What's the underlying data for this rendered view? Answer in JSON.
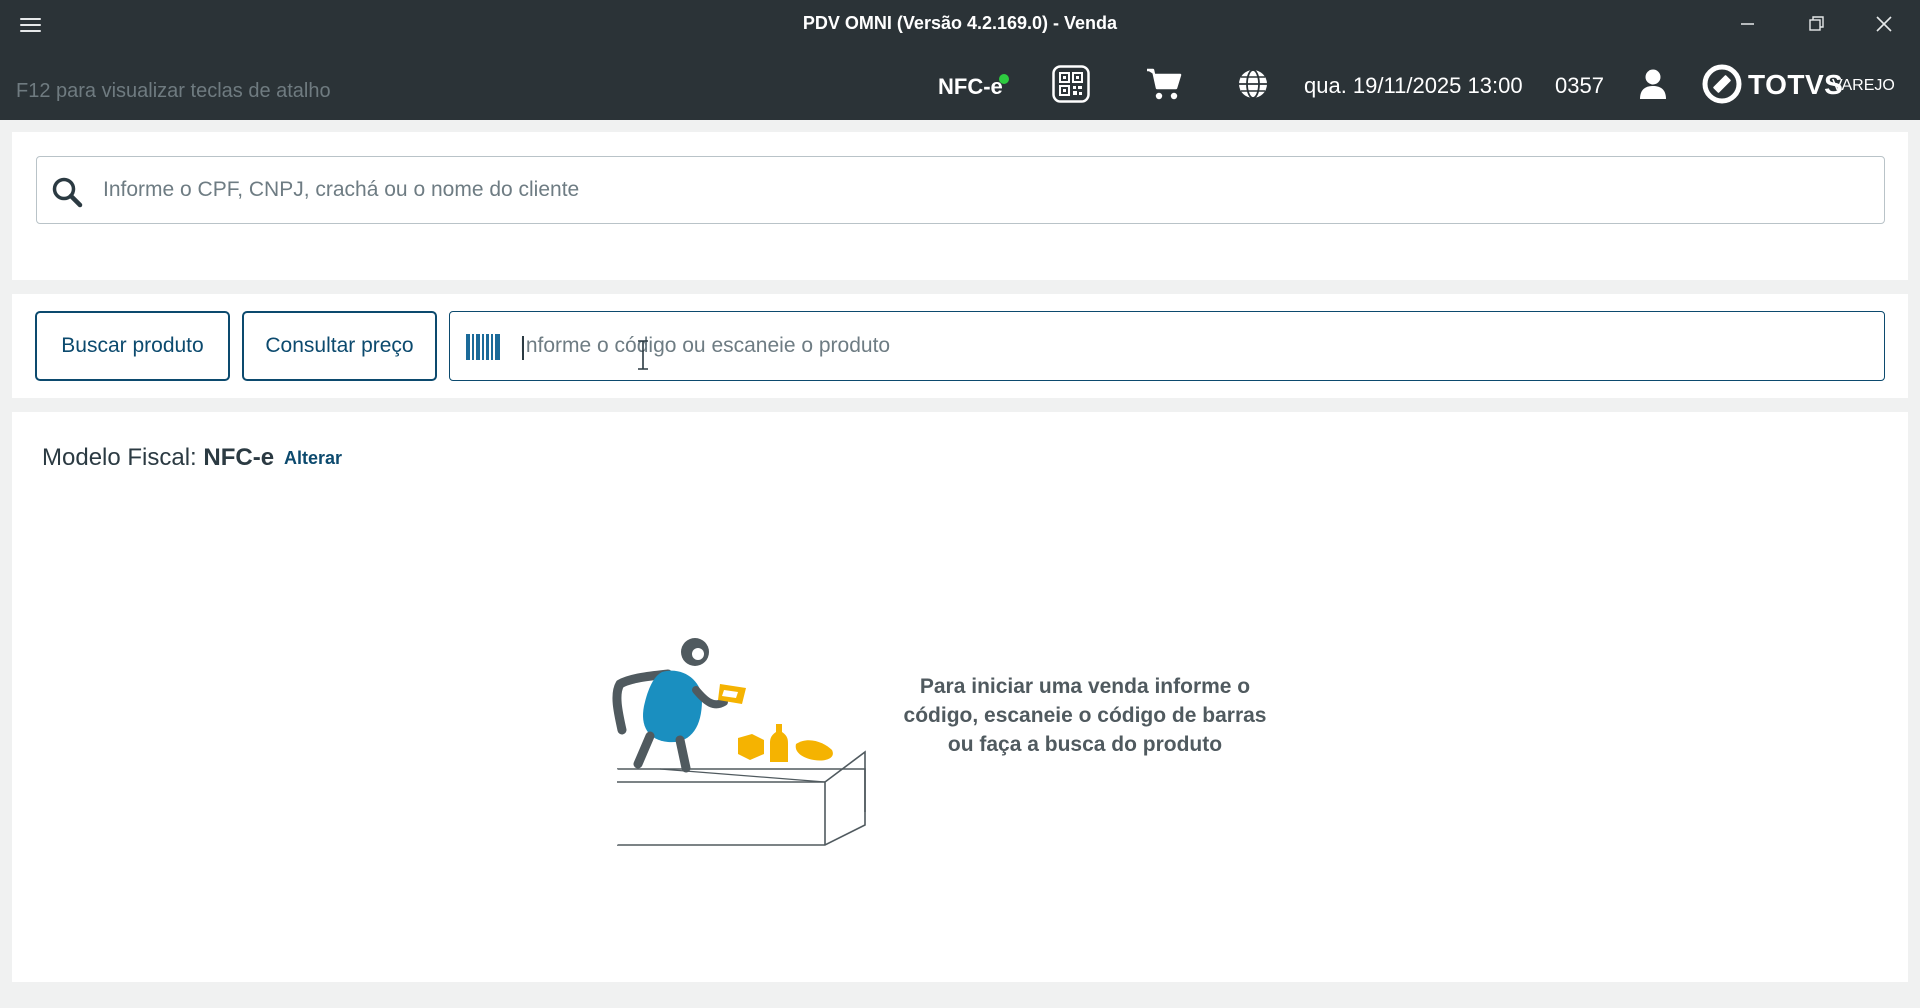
{
  "window": {
    "title": "PDV OMNI (Versão 4.2.169.0) - Venda"
  },
  "statusbar": {
    "shortcut_hint": "F12 para visualizar teclas de atalho",
    "fiscal_badge": "NFC-e",
    "fiscal_badge_status_color": "#2ecc40",
    "datetime": "qua. 19/11/2025 13:00",
    "terminal_number": "0357",
    "brand": "TOTVS",
    "brand_sub": "VAREJO"
  },
  "customer": {
    "search_placeholder": "Informe o CPF, CNPJ, crachá ou o nome do cliente"
  },
  "product": {
    "search_button": "Buscar produto",
    "price_button": "Consultar preço",
    "code_placeholder": "Informe o código ou escaneie o produto"
  },
  "sale": {
    "fiscal_model_label": "Modelo Fiscal:",
    "fiscal_model_value": "NFC-e",
    "change_link": "Alterar",
    "empty_message": "Para iniciar uma venda informe o código, escaneie o código de barras ou faça a busca do produto"
  },
  "colors": {
    "header_bg": "#2b3337",
    "accent": "#0c4a6e",
    "illustration_blue": "#1a8fc0",
    "illustration_yellow": "#f5b301"
  },
  "icons": [
    "menu-icon",
    "minimize-icon",
    "restore-icon",
    "close-icon",
    "qr-code-icon",
    "cart-icon",
    "globe-icon",
    "user-icon",
    "totvs-logo-icon",
    "search-icon",
    "barcode-icon"
  ]
}
